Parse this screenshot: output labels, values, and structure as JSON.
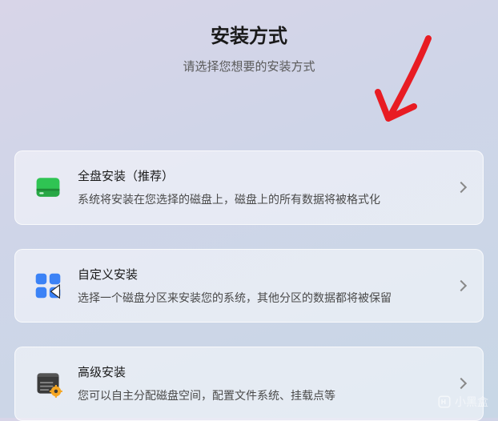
{
  "header": {
    "title": "安装方式",
    "subtitle": "请选择您想要的安装方式"
  },
  "options": [
    {
      "icon": "disk-icon",
      "title": "全盘安装（推荐）",
      "desc": "系统将安装在您选择的磁盘上，磁盘上的所有数据将被格式化"
    },
    {
      "icon": "partition-icon",
      "title": "自定义安装",
      "desc": "选择一个磁盘分区来安装您的系统，其他分区的数据都将被保留"
    },
    {
      "icon": "advanced-icon",
      "title": "高级安装",
      "desc": "您可以自主分配磁盘空间，配置文件系统、挂载点等"
    }
  ],
  "watermark": {
    "text": "小黑盒"
  },
  "annotation": {
    "type": "arrow",
    "color": "#e81c23"
  }
}
